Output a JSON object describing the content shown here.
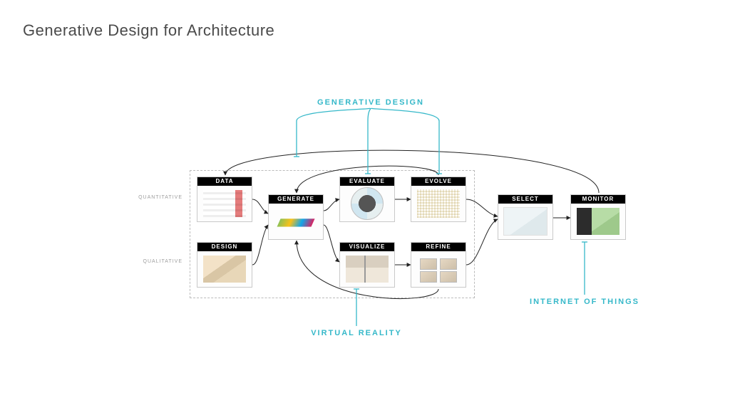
{
  "title": "Generative Design for Architecture",
  "colors": {
    "accent_cyan": "#35b8c9",
    "node_header_bg": "#000000",
    "node_header_fg": "#ffffff",
    "row_label": "#9e9e9e",
    "dashed_border": "#bbbbbb"
  },
  "row_labels": {
    "top": "QUANTITATIVE",
    "bottom": "QUALITATIVE"
  },
  "callouts": {
    "top": "GENERATIVE DESIGN",
    "bottom_left": "VIRTUAL REALITY",
    "bottom_right": "INTERNET OF THINGS"
  },
  "nodes": {
    "data": {
      "label": "DATA",
      "icon": "data-table-icon"
    },
    "design": {
      "label": "DESIGN",
      "icon": "building-sketch-icon"
    },
    "generate": {
      "label": "GENERATE",
      "icon": "generative-blocks-icon"
    },
    "evaluate": {
      "label": "EVALUATE",
      "icon": "radar-chart-icon"
    },
    "evolve": {
      "label": "EVOLVE",
      "icon": "population-grid-icon"
    },
    "visualize": {
      "label": "VISUALIZE",
      "icon": "interior-render-icon"
    },
    "refine": {
      "label": "REFINE",
      "icon": "floorplan-variants-icon"
    },
    "select": {
      "label": "SELECT",
      "icon": "site-model-icon"
    },
    "monitor": {
      "label": "MONITOR",
      "icon": "dashboard-iot-icon"
    }
  },
  "flow_edges": [
    {
      "from": "data",
      "to": "generate"
    },
    {
      "from": "design",
      "to": "generate"
    },
    {
      "from": "generate",
      "to": "evaluate"
    },
    {
      "from": "generate",
      "to": "visualize"
    },
    {
      "from": "evaluate",
      "to": "evolve"
    },
    {
      "from": "visualize",
      "to": "refine"
    },
    {
      "from": "evolve",
      "to": "select"
    },
    {
      "from": "refine",
      "to": "select"
    },
    {
      "from": "select",
      "to": "monitor"
    },
    {
      "from": "evolve",
      "to": "generate",
      "style": "feedback-arc-top"
    },
    {
      "from": "refine",
      "to": "generate",
      "style": "feedback-arc-bottom"
    },
    {
      "from": "monitor",
      "to": "data",
      "style": "feedback-arc-long-top"
    }
  ],
  "callout_links": {
    "top": [
      "generate",
      "evaluate",
      "evolve"
    ],
    "bottom_left": [
      "visualize"
    ],
    "bottom_right": [
      "monitor"
    ]
  }
}
